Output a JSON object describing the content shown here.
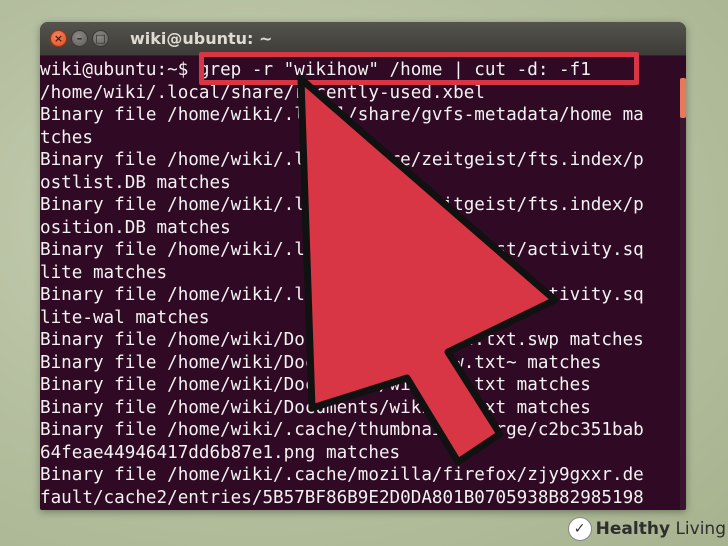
{
  "window": {
    "title": "wiki@ubuntu: ~"
  },
  "terminal": {
    "prompt": "wiki@ubuntu:~$ ",
    "command": "grep -r \"wikihow\" /home | cut -d: -f1",
    "lines": [
      "/home/wiki/.local/share/recently-used.xbel",
      "Binary file /home/wiki/.local/share/gvfs-metadata/home ma",
      "tches",
      "Binary file /home/wiki/.local/share/zeitgeist/fts.index/p",
      "ostlist.DB matches",
      "Binary file /home/wiki/.local/share/zeitgeist/fts.index/p",
      "osition.DB matches",
      "Binary file /home/wiki/.local/share/zeitgeist/activity.sq",
      "lite matches",
      "Binary file /home/wiki/.local/share/zeitgeist/activity.sq",
      "lite-wal matches",
      "Binary file /home/wiki/Documents/.wikihow.txt.swp matches",
      "Binary file /home/wiki/Documents/wikihow.txt~ matches",
      "Binary file /home/wiki/Documents/wikihow.txt matches",
      "Binary file /home/wiki/Documents/wikihow.txt matches",
      "Binary file /home/wiki/.cache/thumbnails/large/c2bc351bab",
      "64feae44946417dd6b87e1.png matches",
      "Binary file /home/wiki/.cache/mozilla/firefox/zjy9gxxr.de",
      "fault/cache2/entries/5B57BF86B9E2D0DA801B0705938B82985198"
    ]
  },
  "watermark": {
    "brand_bold": "Healthy",
    "brand_rest": " Living"
  },
  "colors": {
    "terminal_bg": "#300a24",
    "highlight": "#d93645",
    "arrow_fill": "#d93645",
    "arrow_stroke": "#111111"
  },
  "icons": {
    "close": "close-icon",
    "minimize": "minimize-icon",
    "maximize": "maximize-icon",
    "pointer": "arrow-pointer-icon"
  }
}
